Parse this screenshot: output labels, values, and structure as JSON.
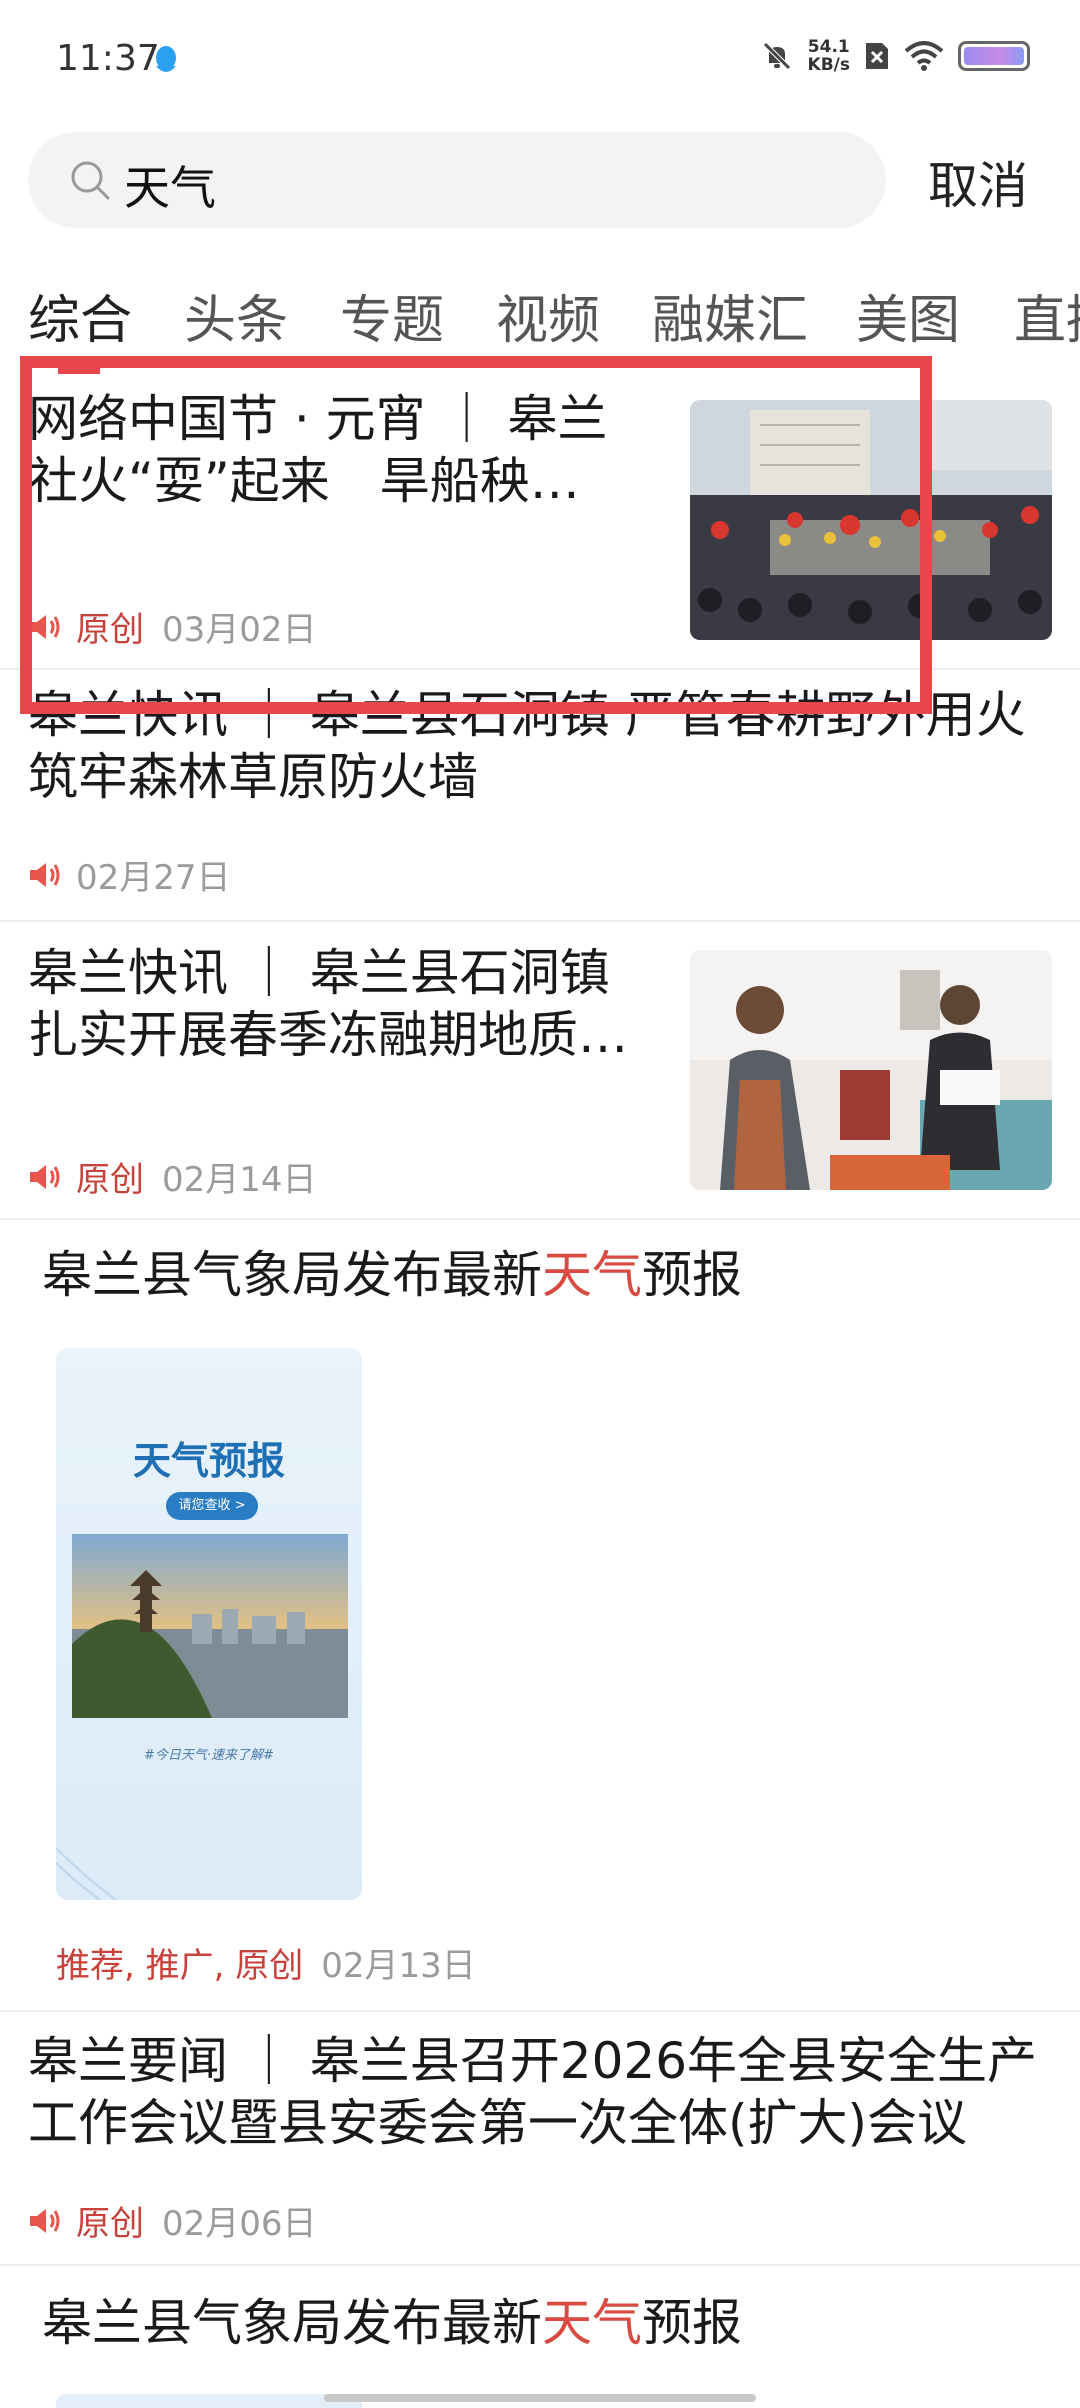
{
  "status": {
    "time": "11:37",
    "speed_value": "54.1",
    "speed_unit": "KB/s"
  },
  "search": {
    "query": "天气",
    "cancel_label": "取消"
  },
  "tabs": [
    {
      "label": "综合"
    },
    {
      "label": "头条"
    },
    {
      "label": "专题"
    },
    {
      "label": "视频"
    },
    {
      "label": "融媒汇"
    },
    {
      "label": "美图"
    },
    {
      "label": "直播"
    }
  ],
  "items": [
    {
      "title_l1": "网络中国节 · 元宵 ｜ 皋兰",
      "title_l2": "社火“耍”起来　旱船秧…",
      "tag": "原创",
      "date": "03月02日"
    },
    {
      "title_l1": "皋兰快讯 ｜ 皋兰县石洞镇 严管春耕野外用火",
      "title_l2": "筑牢森林草原防火墙",
      "date": "02月27日"
    },
    {
      "title_l1": "皋兰快讯 ｜ 皋兰县石洞镇",
      "title_l2": "扎实开展春季冻融期地质…",
      "tag": "原创",
      "date": "02月14日"
    },
    {
      "title_pre": "皋兰县气象局发布最新",
      "title_hl": "天气",
      "title_post": "预报",
      "poster_title": "天气预报",
      "poster_button": "请您查收 >",
      "poster_caption": "#今日天气·速来了解#",
      "tag": "推荐, 推广, 原创",
      "date": "02月13日"
    },
    {
      "title_l1": "皋兰要闻 ｜ 皋兰县召开2026年全县安全生产",
      "title_l2": "工作会议暨县安委会第一次全体(扩大)会议",
      "tag": "原创",
      "date": "02月06日"
    },
    {
      "title_pre": "皋兰县气象局发布最新",
      "title_hl": "天气",
      "title_post": "预报"
    }
  ],
  "colors": {
    "accent": "#e8464c",
    "tag_red": "#c8413b",
    "search_bg": "#f3f3f3"
  }
}
